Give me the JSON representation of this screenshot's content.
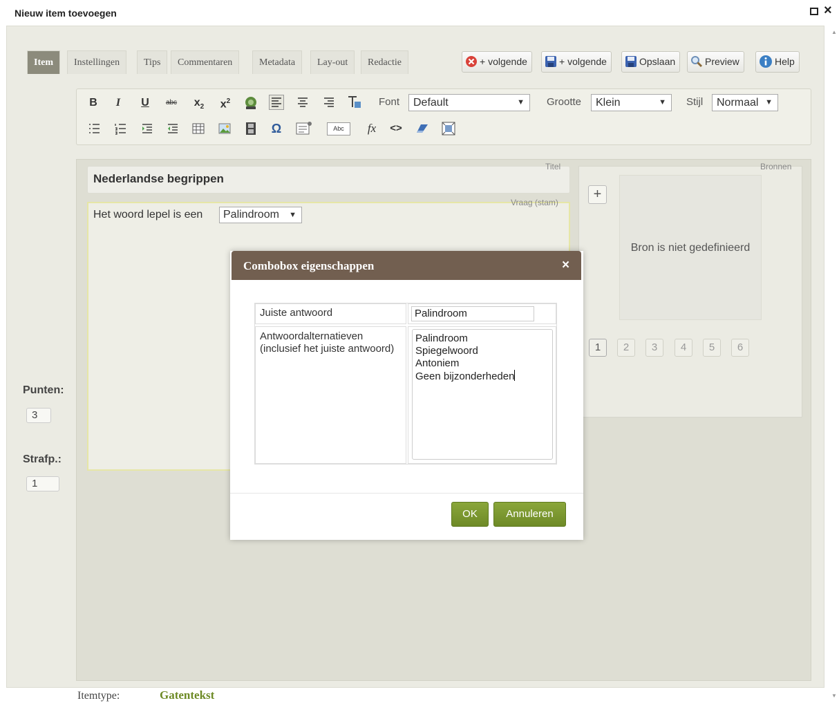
{
  "window": {
    "title": "Nieuw item toevoegen"
  },
  "tabs": [
    "Item",
    "Instellingen",
    "Tips",
    "Commentaren",
    "Metadata",
    "Lay-out",
    "Redactie"
  ],
  "toolbar": {
    "cancel_next": "+ volgende",
    "save_next": "+ volgende",
    "save": "Opslaan",
    "preview": "Preview",
    "help": "Help"
  },
  "editor": {
    "bold": "B",
    "italic": "I",
    "underline": "U",
    "strike": "abc",
    "subscript": "x",
    "superscript": "x",
    "sub_mark": "2",
    "sup_mark": "2",
    "abc_box": "Abc",
    "formula": "fx",
    "source": "<>",
    "font_label": "Font",
    "font_value": "Default",
    "size_label": "Grootte",
    "size_value": "Klein",
    "style_label": "Stijl",
    "style_value": "Normaal"
  },
  "item": {
    "title_label": "Titel",
    "title": "Nederlandse begrippen",
    "question_label": "Vraag (stam)",
    "question_text": "Het woord lepel is een",
    "question_combo": "Palindroom",
    "sources_label": "Bronnen",
    "add_source": "+",
    "source_empty": "Bron is niet gedefinieerd",
    "pages": [
      "1",
      "2",
      "3",
      "4",
      "5",
      "6"
    ]
  },
  "points": {
    "label": "Punten:",
    "value": "3"
  },
  "penalty": {
    "label": "Strafp.:",
    "value": "1"
  },
  "dialog": {
    "title": "Combobox eigenschappen",
    "close": "×",
    "correct_label": "Juiste antwoord",
    "correct_value": "Palindroom",
    "alternatives_label_1": "Antwoordalternatieven",
    "alternatives_label_2": "(inclusief het juiste antwoord)",
    "alternatives": [
      "Palindroom",
      "Spiegelwoord",
      "Antoniem",
      "Geen bijzonderheden"
    ],
    "ok": "OK",
    "cancel": "Annuleren"
  },
  "footer": {
    "itemtype_label": "Itemtype:",
    "itemtype_value": "Gatentekst"
  },
  "colors": {
    "dialog_header": "#725f50",
    "green_button": "#7c9830",
    "active_tab": "#8c8b7c",
    "itemtype": "#6d8a25"
  }
}
